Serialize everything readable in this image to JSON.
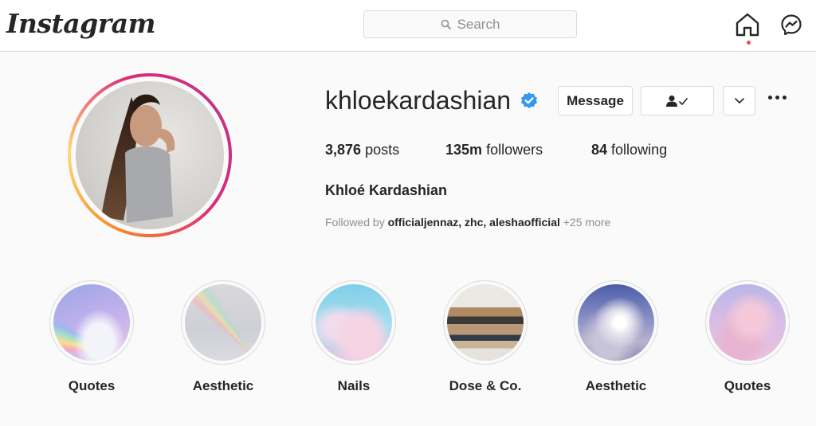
{
  "header": {
    "logo": "Instagram",
    "search_placeholder": "Search"
  },
  "profile": {
    "username": "khloekardashian",
    "verified": true,
    "message_label": "Message",
    "stats": {
      "posts_count": "3,876",
      "posts_label": "posts",
      "followers_count": "135m",
      "followers_label": "followers",
      "following_count": "84",
      "following_label": "following"
    },
    "full_name": "Khloé Kardashian",
    "followed_by_prefix": "Followed by",
    "followed_by_names": "officialjennaz, zhc, aleshaofficial",
    "followed_by_more": "+25 more"
  },
  "highlights": [
    {
      "label": "Quotes"
    },
    {
      "label": "Aesthetic"
    },
    {
      "label": "Nails"
    },
    {
      "label": "Dose & Co."
    },
    {
      "label": "Aesthetic"
    },
    {
      "label": "Quotes"
    }
  ],
  "colors": {
    "accent_blue": "#3897f0",
    "notification_red": "#ed4956",
    "text": "#262626",
    "muted": "#8e8e8e",
    "border": "#dbdbdb"
  },
  "icons": [
    "search-icon",
    "home-icon",
    "messenger-icon",
    "verified-badge-icon",
    "following-person-check-icon",
    "chevron-down-icon",
    "more-options-icon"
  ]
}
